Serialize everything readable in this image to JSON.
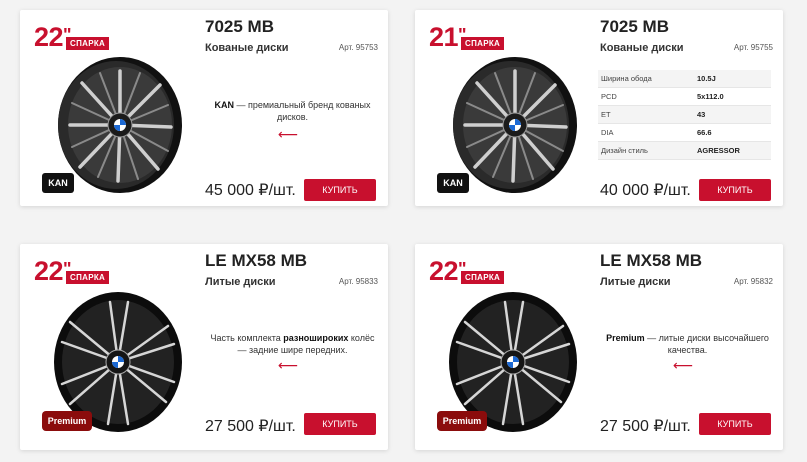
{
  "cards": [
    {
      "size": "22",
      "size_mark": "\"",
      "badge": "СПАРКА",
      "title": "7025 MB",
      "subtitle": "Кованые диски",
      "art": "Арт. 95753",
      "brand": "KAN",
      "desc_bold": "KAN",
      "desc_text": " — премиальный бренд кованых дисков.",
      "price": "45 000 ₽/шт.",
      "buy": "КУПИТЬ",
      "wheel_style": "forged"
    },
    {
      "size": "21",
      "size_mark": "\"",
      "badge": "СПАРКА",
      "title": "7025 MB",
      "subtitle": "Кованые диски",
      "art": "Арт. 95755",
      "brand": "KAN",
      "specs": [
        {
          "k": "Ширина обода",
          "v": "10.5J"
        },
        {
          "k": "PCD",
          "v": "5x112.0"
        },
        {
          "k": "ET",
          "v": "43"
        },
        {
          "k": "DIA",
          "v": "66.6"
        },
        {
          "k": "Дизайн стиль",
          "v": "AGRESSOR"
        }
      ],
      "price": "40 000 ₽/шт.",
      "buy": "КУПИТЬ",
      "wheel_style": "forged"
    },
    {
      "size": "22",
      "size_mark": "\"",
      "badge": "СПАРКА",
      "title": "LE MX58 MB",
      "subtitle": "Литые диски",
      "art": "Арт. 95833",
      "brand": "Premium",
      "desc_pre": "Часть комплекта ",
      "desc_bold": "разноширокиx",
      "desc_text": " колёс — задние шире передних.",
      "price": "27 500 ₽/шт.",
      "buy": "КУПИТЬ",
      "wheel_style": "cast"
    },
    {
      "size": "22",
      "size_mark": "\"",
      "badge": "СПАРКА",
      "title": "LE MX58 MB",
      "subtitle": "Литые диски",
      "art": "Арт. 95832",
      "brand": "Premium",
      "desc_bold": "Premium",
      "desc_text": " — литые диски высочайшего качества.",
      "price": "27 500 ₽/шт.",
      "buy": "КУПИТЬ",
      "wheel_style": "cast"
    }
  ],
  "colors": {
    "accent": "#c8102e",
    "premium_badge": "#8b0c0c",
    "kan_badge": "#111111"
  },
  "icons": {
    "arrow": "left-arrow-icon"
  }
}
